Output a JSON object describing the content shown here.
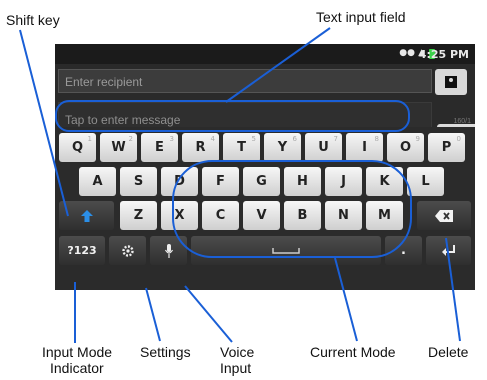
{
  "callouts": {
    "shift_key": "Shift key",
    "text_input_field": "Text input field",
    "input_mode_indicator_line1": "Input Mode",
    "input_mode_indicator_line2": "Indicator",
    "settings": "Settings",
    "voice_input_line1": "Voice",
    "voice_input_line2": "Input",
    "current_mode": "Current Mode",
    "delete": "Delete"
  },
  "status_bar": {
    "time": "4:25 PM",
    "icons": [
      "wifi-icon",
      "signal-icon",
      "battery-icon"
    ]
  },
  "compose": {
    "recipient_placeholder": "Enter recipient",
    "message_placeholder": "Tap to enter message",
    "counter": "160/1"
  },
  "keyboard": {
    "row1": [
      {
        "label": "Q",
        "hint": "1"
      },
      {
        "label": "W",
        "hint": "2"
      },
      {
        "label": "E",
        "hint": "3"
      },
      {
        "label": "R",
        "hint": "4"
      },
      {
        "label": "T",
        "hint": "5"
      },
      {
        "label": "Y",
        "hint": "6"
      },
      {
        "label": "U",
        "hint": "7"
      },
      {
        "label": "I",
        "hint": "8"
      },
      {
        "label": "O",
        "hint": "9"
      },
      {
        "label": "P",
        "hint": "0"
      }
    ],
    "row2": [
      "A",
      "S",
      "D",
      "F",
      "G",
      "H",
      "J",
      "K",
      "L"
    ],
    "row3": [
      "Z",
      "X",
      "C",
      "V",
      "B",
      "N",
      "M"
    ],
    "mode_key": "?123",
    "period_key": "."
  },
  "colors": {
    "callout_line": "#1a5fd6",
    "shift_arrow": "#2b8fe8",
    "highlight": "#1a5fd6"
  }
}
